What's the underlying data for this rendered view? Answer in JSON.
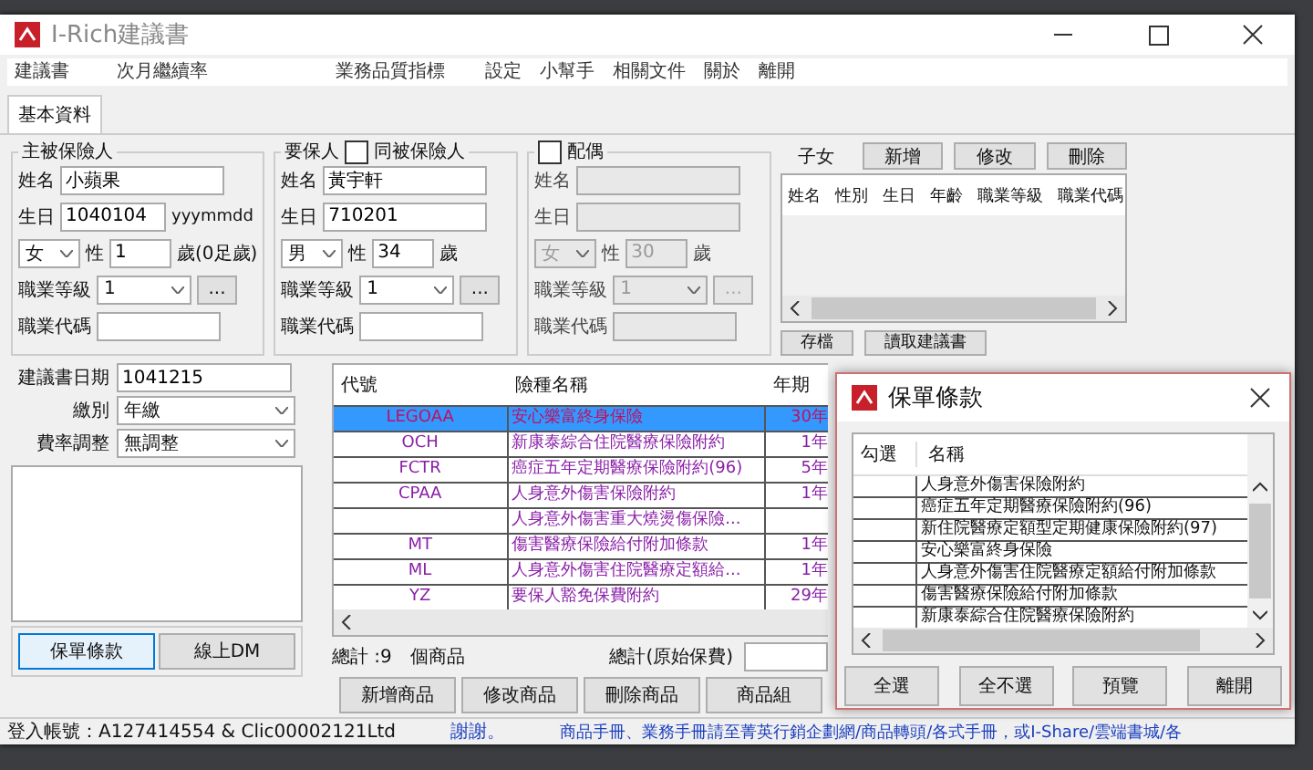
{
  "window": {
    "title": "I-Rich建議書"
  },
  "menu": [
    "建議書",
    "次月繼續率",
    "業務品質指標",
    "設定",
    "小幫手",
    "相關文件",
    "關於",
    "離開"
  ],
  "tabs": [
    {
      "label": "基本資料",
      "selected": true
    }
  ],
  "persons": [
    {
      "title": "主被保險人",
      "disabled": false,
      "name_label": "姓名",
      "name": "小蘋果",
      "birth_label": "生日",
      "birth": "1040104",
      "birth_hint": "yyymmdd",
      "gender": "女",
      "gender_label": "性",
      "age": "1",
      "age_unit": "歲(0足歲)",
      "job_level_label": "職業等級",
      "job_level": "1",
      "more": "...",
      "job_code_label": "職業代碼"
    },
    {
      "title": "要保人",
      "checkbox": {
        "label": "同被保險人",
        "checked": false
      },
      "disabled": false,
      "name_label": "姓名",
      "name": "黃宇軒",
      "birth_label": "生日",
      "birth": "710201",
      "gender": "男",
      "gender_label": "性",
      "age": "34",
      "age_unit": "歲",
      "job_level_label": "職業等級",
      "job_level": "1",
      "more": "...",
      "job_code_label": "職業代碼"
    },
    {
      "checkbox": {
        "label": "配偶",
        "checked": false
      },
      "disabled": true,
      "name_label": "姓名",
      "birth_label": "生日",
      "gender": "女",
      "gender_label": "性",
      "age": "30",
      "age_unit": "歲",
      "job_level_label": "職業等級",
      "job_level": "1",
      "more": "...",
      "job_code_label": "職業代碼"
    }
  ],
  "children": {
    "title": "子女",
    "buttons": [
      "新增",
      "修改",
      "刪除"
    ],
    "columns": [
      "姓名",
      "性別",
      "生日",
      "年齡",
      "職業等級",
      "職業代碼"
    ]
  },
  "actions": [
    "存檔",
    "讀取建議書"
  ],
  "proposal": {
    "date_label": "建議書日期",
    "date": "1041215",
    "pay_label": "繳別",
    "pay": "年繳",
    "rate_label": "費率調整",
    "rate": "無調整"
  },
  "side_buttons": [
    {
      "label": "保單條款",
      "focused": true
    },
    {
      "label": "線上DM",
      "focused": false
    }
  ],
  "products": {
    "columns": [
      "代號",
      "險種名稱",
      "年期"
    ],
    "rows": [
      {
        "code": "LEGOAA",
        "name": "安心樂富終身保險",
        "term": "30年",
        "selected": true
      },
      {
        "code": "OCH",
        "name": "新康泰綜合住院醫療保險附約",
        "term": "1年",
        "selected": false
      },
      {
        "code": "FCTR",
        "name": "癌症五年定期醫療保險附約(96)",
        "term": "5年",
        "selected": false
      },
      {
        "code": "CPAA",
        "name": "人身意外傷害保險附約",
        "term": "1年",
        "selected": false
      },
      {
        "code": "",
        "name": "人身意外傷害重大燒燙傷保險...",
        "term": "",
        "selected": false
      },
      {
        "code": "MT",
        "name": "傷害醫療保險給付附加條款",
        "term": "1年",
        "selected": false
      },
      {
        "code": "ML",
        "name": "人身意外傷害住院醫療定額給...",
        "term": "1年",
        "selected": false
      },
      {
        "code": "YZ",
        "name": "要保人豁免保費附約",
        "term": "29年",
        "selected": false
      }
    ],
    "count": "總計 :9　個商品",
    "premium_label": "總計(原始保費)",
    "buttons": [
      "新增商品",
      "修改商品",
      "刪除商品",
      "商品組"
    ]
  },
  "status_bar": {
    "account": "登入帳號：A127414554 & Clic00002121Ltd",
    "thanks": "謝謝。",
    "notice": "商品手冊、業務手冊請至菁英行銷企劃網/商品轉頭/各式手冊，或I-Share/雲端書城/各"
  },
  "dialog": {
    "title": "保單條款",
    "columns": [
      "勾選",
      "名稱"
    ],
    "rows": [
      "人身意外傷害保險附約",
      "癌症五年定期醫療保險附約(96)",
      "新住院醫療定額型定期健康保險附約(97)",
      "安心樂富終身保險",
      "人身意外傷害住院醫療定額給付附加條款",
      "傷害醫療保險給付附加條款",
      "新康泰綜合住院醫療保險附約"
    ],
    "buttons": [
      "全選",
      "全不選",
      "預覽",
      "離開"
    ]
  }
}
